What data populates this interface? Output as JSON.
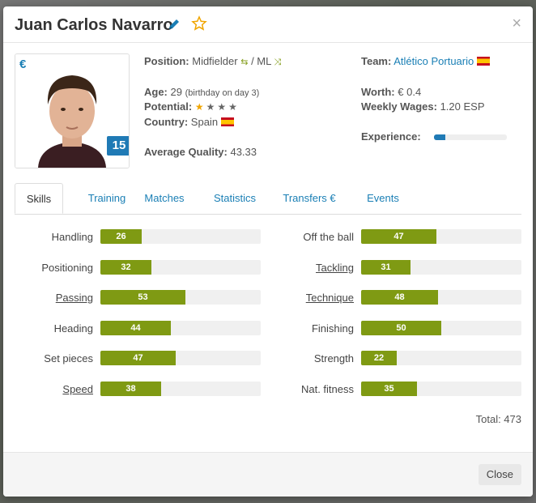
{
  "header": {
    "title": "Juan Carlos Navarro"
  },
  "photo": {
    "euro": "€",
    "shirt_number": "15"
  },
  "info": {
    "position_label": "Position:",
    "position_value": "Midfielder",
    "position_sep": "/ ML",
    "age_label": "Age:",
    "age_value": "29",
    "age_note": "(birthday on day 3)",
    "potential_label": "Potential:",
    "potential_stars": 4,
    "potential_filled": 1,
    "country_label": "Country:",
    "country_value": "Spain",
    "avg_label": "Average Quality:",
    "avg_value": "43.33",
    "team_label": "Team:",
    "team_value": "Atlético Portuario",
    "worth_label": "Worth:",
    "worth_value": "€ 0.4",
    "wages_label": "Weekly Wages:",
    "wages_value": "1.20 ESP",
    "experience_label": "Experience:",
    "experience_fraction": 0.15
  },
  "tabs": [
    "Skills",
    "Training",
    "Matches",
    "Statistics",
    "Transfers €",
    "Events"
  ],
  "skills_left": [
    {
      "name": "Handling",
      "value": "26",
      "underline": false
    },
    {
      "name": "Positioning",
      "value": "32",
      "underline": false
    },
    {
      "name": "Passing",
      "value": "53",
      "underline": true
    },
    {
      "name": "Heading",
      "value": "44",
      "underline": false
    },
    {
      "name": "Set pieces",
      "value": "47",
      "underline": false
    },
    {
      "name": "Speed",
      "value": "38",
      "underline": true
    }
  ],
  "skills_right": [
    {
      "name": "Off the ball",
      "value": "47",
      "underline": false
    },
    {
      "name": "Tackling",
      "value": "31",
      "underline": true
    },
    {
      "name": "Technique",
      "value": "48",
      "underline": true
    },
    {
      "name": "Finishing",
      "value": "50",
      "underline": false
    },
    {
      "name": "Strength",
      "value": "22",
      "underline": false
    },
    {
      "name": "Nat. fitness",
      "value": "35",
      "underline": false
    }
  ],
  "total": "Total: 473",
  "footer": {
    "close_label": "Close"
  },
  "colors": {
    "accent": "#1a7fb5",
    "skill_fill": "#7f9a13",
    "star": "#f0a500"
  }
}
